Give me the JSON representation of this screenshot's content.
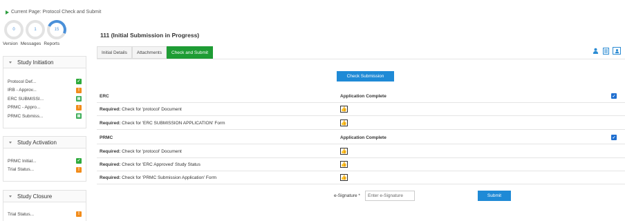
{
  "header": {
    "current_page_label": "Current Page: Protocol Check and Submit"
  },
  "stats": [
    {
      "value": "0",
      "label": "Version"
    },
    {
      "value": "1",
      "label": "Messages"
    },
    {
      "value": "15",
      "label": "Reports"
    }
  ],
  "sidebar": {
    "initiation": {
      "title": "Study Initiation",
      "items": [
        {
          "label": "Protocol Def...",
          "status": "complete"
        },
        {
          "label": "IRB - Approv...",
          "status": "warning"
        },
        {
          "label": "ERC SUBMISSI...",
          "status": "document"
        },
        {
          "label": "PRMC - Appro...",
          "status": "warning"
        },
        {
          "label": "PRMC Submiss...",
          "status": "document"
        }
      ]
    },
    "activation": {
      "title": "Study Activation",
      "items": [
        {
          "label": "PRMC Initial...",
          "status": "complete"
        },
        {
          "label": "Trial Status...",
          "status": "warning"
        }
      ]
    },
    "closure": {
      "title": "Study Closure",
      "items": [
        {
          "label": "Trial Status...",
          "status": "warning"
        }
      ]
    }
  },
  "main": {
    "title": "111 (Initial Submission in Progress)",
    "tabs": [
      "Initial Details",
      "Attachments",
      "Check and Submit"
    ],
    "active_tab": "Check and Submit",
    "check_button": "Check Submission",
    "sections": [
      {
        "name": "ERC",
        "status": "Application Complete",
        "checks": [
          {
            "prefix": "Required:",
            "text": "Check for 'protocol' Document"
          },
          {
            "prefix": "Required:",
            "text": "Check for 'ERC SUBMISSION APPLICATION' Form"
          }
        ]
      },
      {
        "name": "PRMC",
        "status": "Application Complete",
        "checks": [
          {
            "prefix": "Required:",
            "text": "Check for 'protocol' Document"
          },
          {
            "prefix": "Required:",
            "text": "Check for 'ERC Approved' Study Status"
          },
          {
            "prefix": "Required:",
            "text": "Check for 'PRMC Submission Application' Form"
          }
        ]
      }
    ],
    "esignature": {
      "label": "e-Signature *",
      "placeholder": "Enter e-Signature",
      "value": ""
    },
    "submit_button": "Submit"
  },
  "colors": {
    "accent_green": "#1e9c34",
    "accent_blue": "#1f8ad6",
    "warning_orange": "#f28c1b"
  }
}
